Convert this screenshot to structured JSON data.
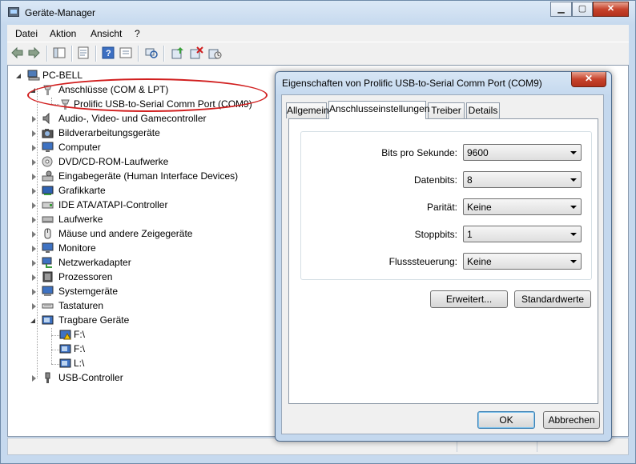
{
  "window": {
    "title": "Geräte-Manager",
    "controls": {
      "minimize": "▁",
      "maximize": "▢",
      "close": "✕"
    }
  },
  "menu": [
    "Datei",
    "Aktion",
    "Ansicht",
    "?"
  ],
  "toolbar": [
    "back-icon",
    "forward-icon",
    "show-hide-tree-icon",
    "properties-icon",
    "help-icon",
    "show-hidden-icon",
    "update-driver-icon",
    "disable-device-icon",
    "uninstall-device-icon"
  ],
  "tree": {
    "root": "PC-BELL",
    "items": [
      {
        "label": "Anschlüsse (COM & LPT)",
        "icon": "port-icon",
        "expanded": true
      },
      {
        "label": "Prolific USB-to-Serial Comm Port (COM9)",
        "icon": "port-icon",
        "child": true
      },
      {
        "label": "Audio-, Video- und Gamecontroller",
        "icon": "speaker-icon"
      },
      {
        "label": "Bildverarbeitungsgeräte",
        "icon": "camera-icon"
      },
      {
        "label": "Computer",
        "icon": "computer-icon"
      },
      {
        "label": "DVD/CD-ROM-Laufwerke",
        "icon": "disc-icon"
      },
      {
        "label": "Eingabegeräte (Human Interface Devices)",
        "icon": "hid-icon"
      },
      {
        "label": "Grafikkarte",
        "icon": "display-adapter-icon"
      },
      {
        "label": "IDE ATA/ATAPI-Controller",
        "icon": "ide-icon"
      },
      {
        "label": "Laufwerke",
        "icon": "drive-icon"
      },
      {
        "label": "Mäuse und andere Zeigegeräte",
        "icon": "mouse-icon"
      },
      {
        "label": "Monitore",
        "icon": "monitor-icon"
      },
      {
        "label": "Netzwerkadapter",
        "icon": "network-icon"
      },
      {
        "label": "Prozessoren",
        "icon": "processor-icon"
      },
      {
        "label": "Systemgeräte",
        "icon": "system-icon"
      },
      {
        "label": "Tastaturen",
        "icon": "keyboard-icon"
      },
      {
        "label": "Tragbare Geräte",
        "icon": "portable-device-icon",
        "expanded": true
      },
      {
        "label": "F:\\",
        "icon": "portable-warning-icon",
        "child": true
      },
      {
        "label": "F:\\",
        "icon": "portable-device-icon",
        "child": true
      },
      {
        "label": "L:\\",
        "icon": "portable-device-icon",
        "child": true
      },
      {
        "label": "USB-Controller",
        "icon": "usb-icon"
      }
    ]
  },
  "dialog": {
    "title": "Eigenschaften von Prolific USB-to-Serial Comm Port (COM9)",
    "close": "✕",
    "tabs": [
      "Allgemein",
      "Anschlusseinstellungen",
      "Treiber",
      "Details"
    ],
    "active_tab": "Anschlusseinstellungen",
    "fields": [
      {
        "label": "Bits pro Sekunde:",
        "value": "9600"
      },
      {
        "label": "Datenbits:",
        "value": "8"
      },
      {
        "label": "Parität:",
        "value": "Keine"
      },
      {
        "label": "Stoppbits:",
        "value": "1"
      },
      {
        "label": "Flusssteuerung:",
        "value": "Keine"
      }
    ],
    "buttons": {
      "advanced": "Erweitert...",
      "defaults": "Standardwerte",
      "ok": "OK",
      "cancel": "Abbrechen"
    }
  },
  "colors": {
    "highlight_ellipse": "#d11f1f",
    "default_button_border": "#3c7fb1"
  }
}
